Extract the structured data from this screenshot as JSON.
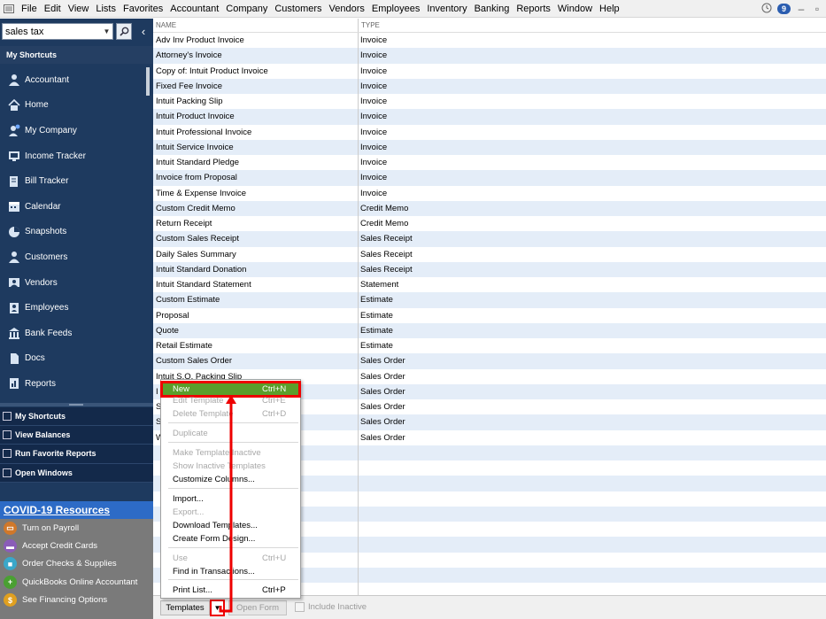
{
  "menubar": {
    "items": [
      "File",
      "Edit",
      "View",
      "Lists",
      "Favorites",
      "Accountant",
      "Company",
      "Customers",
      "Vendors",
      "Employees",
      "Inventory",
      "Banking",
      "Reports",
      "Window",
      "Help"
    ],
    "alert_count": "9"
  },
  "sidebar": {
    "search_value": "sales tax",
    "shortcuts_header": "My Shortcuts",
    "shortcuts": [
      {
        "label": "Accountant",
        "icon": "accountant-icon"
      },
      {
        "label": "Home",
        "icon": "home-icon"
      },
      {
        "label": "My Company",
        "icon": "company-icon"
      },
      {
        "label": "Income Tracker",
        "icon": "income-tracker-icon"
      },
      {
        "label": "Bill Tracker",
        "icon": "bill-tracker-icon"
      },
      {
        "label": "Calendar",
        "icon": "calendar-icon"
      },
      {
        "label": "Snapshots",
        "icon": "snapshots-icon"
      },
      {
        "label": "Customers",
        "icon": "customers-icon"
      },
      {
        "label": "Vendors",
        "icon": "vendors-icon"
      },
      {
        "label": "Employees",
        "icon": "employees-icon"
      },
      {
        "label": "Bank Feeds",
        "icon": "bank-icon"
      },
      {
        "label": "Docs",
        "icon": "docs-icon"
      },
      {
        "label": "Reports",
        "icon": "reports-icon"
      }
    ],
    "panel_links": [
      "My Shortcuts",
      "View Balances",
      "Run Favorite Reports",
      "Open Windows"
    ],
    "covid_label": "COVID-19 Resources",
    "promos": [
      {
        "label": "Turn on Payroll",
        "color": "#d0782a"
      },
      {
        "label": "Accept Credit Cards",
        "color": "#8a5cb8"
      },
      {
        "label": "Order Checks & Supplies",
        "color": "#3aa7c9"
      },
      {
        "label": "QuickBooks Online Accountant",
        "color": "#4aa032"
      },
      {
        "label": "See Financing Options",
        "color": "#e0a020"
      }
    ]
  },
  "table": {
    "col_name": "NAME",
    "col_type": "TYPE",
    "rows": [
      [
        "Adv Inv Product Invoice",
        "Invoice"
      ],
      [
        "Attorney's Invoice",
        "Invoice"
      ],
      [
        "Copy of: Intuit Product Invoice",
        "Invoice"
      ],
      [
        "Fixed Fee Invoice",
        "Invoice"
      ],
      [
        "Intuit Packing Slip",
        "Invoice"
      ],
      [
        "Intuit Product Invoice",
        "Invoice"
      ],
      [
        "Intuit Professional Invoice",
        "Invoice"
      ],
      [
        "Intuit Service Invoice",
        "Invoice"
      ],
      [
        "Intuit Standard Pledge",
        "Invoice"
      ],
      [
        "Invoice from Proposal",
        "Invoice"
      ],
      [
        "Time & Expense Invoice",
        "Invoice"
      ],
      [
        "Custom Credit Memo",
        "Credit Memo"
      ],
      [
        "Return Receipt",
        "Credit Memo"
      ],
      [
        "Custom Sales Receipt",
        "Sales Receipt"
      ],
      [
        "Daily Sales Summary",
        "Sales Receipt"
      ],
      [
        "Intuit Standard Donation",
        "Sales Receipt"
      ],
      [
        "Intuit Standard Statement",
        "Statement"
      ],
      [
        "Custom Estimate",
        "Estimate"
      ],
      [
        "Proposal",
        "Estimate"
      ],
      [
        "Quote",
        "Estimate"
      ],
      [
        "Retail Estimate",
        "Estimate"
      ],
      [
        "Custom Sales Order",
        "Sales Order"
      ],
      [
        "Intuit S.O. Packing Slip",
        "Sales Order"
      ],
      [
        "I",
        "Sales Order"
      ],
      [
        "S",
        "Sales Order"
      ],
      [
        "S",
        "Sales Order"
      ],
      [
        "W",
        "Sales Order"
      ]
    ]
  },
  "bottombar": {
    "templates_label": "Templates",
    "open_form_label": "Open Form",
    "include_inactive_label": "Include Inactive"
  },
  "context_menu": {
    "items": [
      {
        "label": "New",
        "shortcut": "Ctrl+N",
        "state": "highlight"
      },
      {
        "label": "Edit Template",
        "shortcut": "Ctrl+E",
        "state": "disabled"
      },
      {
        "label": "Delete Template",
        "shortcut": "Ctrl+D",
        "state": "disabled"
      },
      {
        "label": "Duplicate",
        "shortcut": "",
        "state": "disabled"
      },
      {
        "label": "Make Template Inactive",
        "shortcut": "",
        "state": "disabled"
      },
      {
        "label": "Show Inactive Templates",
        "shortcut": "",
        "state": "disabled"
      },
      {
        "label": "Customize Columns...",
        "shortcut": "",
        "state": "enabled"
      },
      {
        "label": "Import...",
        "shortcut": "",
        "state": "enabled"
      },
      {
        "label": "Export...",
        "shortcut": "",
        "state": "disabled"
      },
      {
        "label": "Download Templates...",
        "shortcut": "",
        "state": "enabled"
      },
      {
        "label": "Create Form Design...",
        "shortcut": "",
        "state": "enabled"
      },
      {
        "label": "Use",
        "shortcut": "Ctrl+U",
        "state": "disabled"
      },
      {
        "label": "Find in Transactions...",
        "shortcut": "",
        "state": "enabled"
      },
      {
        "label": "Print List...",
        "shortcut": "Ctrl+P",
        "state": "enabled"
      }
    ]
  }
}
